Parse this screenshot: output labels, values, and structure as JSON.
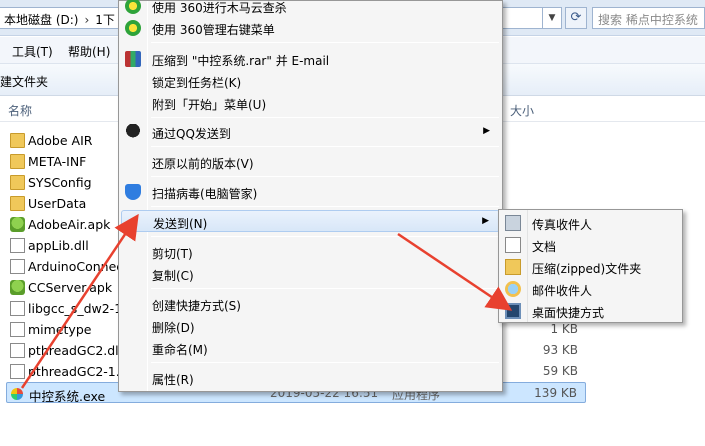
{
  "address": {
    "drive": "本地磁盘 (D:)",
    "next": "1下",
    "search_placeholder": "搜索 稀点中控系统"
  },
  "menubar": {
    "tools": "工具(T)",
    "help": "帮助(H)"
  },
  "toolbar": {
    "new_folder": "建文件夹"
  },
  "columns": {
    "name": "名称",
    "size": "大小"
  },
  "files": [
    {
      "name": "Adobe AIR",
      "icon": "folder-icon",
      "size": ""
    },
    {
      "name": "META-INF",
      "icon": "folder-icon",
      "size": ""
    },
    {
      "name": "SYSConfig",
      "icon": "folder-icon",
      "size": ""
    },
    {
      "name": "UserData",
      "icon": "folder-icon",
      "size": ""
    },
    {
      "name": "AdobeAir.apk",
      "icon": "apk-icon",
      "size": ""
    },
    {
      "name": "appLib.dll",
      "icon": "dll-icon",
      "size": ""
    },
    {
      "name": "ArduinoConnec",
      "icon": "document-icon",
      "size": ""
    },
    {
      "name": "CCServer.apk",
      "icon": "apk-icon",
      "size": ""
    },
    {
      "name": "libgcc_s_dw2-1.",
      "icon": "dll-icon",
      "size": ""
    },
    {
      "name": "mimetype",
      "icon": "document-icon",
      "size": "1 KB"
    },
    {
      "name": "pthreadGC2.dll",
      "icon": "dll-icon",
      "size": "93 KB"
    },
    {
      "name": "pthreadGC2-1.",
      "icon": "dll-icon",
      "size": "59 KB"
    },
    {
      "name": "中控系统.exe",
      "icon": "exe-icon",
      "size": "139 KB",
      "date": "2019-05-22 16:51",
      "type": "应用程序"
    }
  ],
  "context_menu": {
    "items": [
      {
        "label": "使用 360进行木马云查杀",
        "icon": "360-icon"
      },
      {
        "label": "使用 360管理右键菜单",
        "icon": "360-icon"
      },
      {
        "label": "压缩到 \"中控系统.rar\" 并 E-mail",
        "icon": "winrar-icon"
      },
      {
        "label": "锁定到任务栏(K)"
      },
      {
        "label": "附到「开始」菜单(U)"
      },
      {
        "label": "通过QQ发送到",
        "icon": "qq-icon",
        "submenu": true
      },
      {
        "label": "还原以前的版本(V)"
      },
      {
        "label": "扫描病毒(电脑管家)",
        "icon": "shield-icon"
      },
      {
        "label": "发送到(N)",
        "submenu": true,
        "highlighted": true
      },
      {
        "label": "剪切(T)"
      },
      {
        "label": "复制(C)"
      },
      {
        "label": "创建快捷方式(S)"
      },
      {
        "label": "删除(D)"
      },
      {
        "label": "重命名(M)"
      },
      {
        "label": "属性(R)"
      }
    ]
  },
  "send_to_menu": {
    "items": [
      {
        "label": "传真收件人",
        "icon": "fax-icon"
      },
      {
        "label": "文档",
        "icon": "documents-icon"
      },
      {
        "label": "压缩(zipped)文件夹",
        "icon": "zip-folder-icon"
      },
      {
        "label": "邮件收件人",
        "icon": "mail-icon"
      },
      {
        "label": "桌面快捷方式",
        "icon": "desktop-icon"
      }
    ]
  },
  "colors": {
    "selection": "#cce6ff",
    "arrow": "#e8412f",
    "menu_bg": "#f5f5f5"
  }
}
